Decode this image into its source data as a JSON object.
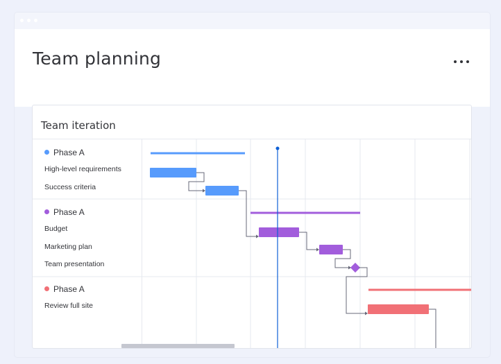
{
  "page": {
    "title": "Team planning",
    "more_icon": "more-horizontal-icon"
  },
  "card": {
    "title": "Team iteration"
  },
  "groups": [
    {
      "name": "Phase A",
      "color": "#579bfc",
      "tasks": [
        "High-level requirements",
        "Success criteria"
      ]
    },
    {
      "name": "Phase A",
      "color": "#a25ddc",
      "tasks": [
        "Budget",
        "Marketing plan",
        "Team presentation"
      ]
    },
    {
      "name": "Phase A",
      "color": "#f17076",
      "tasks": [
        "Review full site"
      ]
    }
  ],
  "colors": {
    "blue": "#579bfc",
    "purple": "#a25ddc",
    "red": "#f17076",
    "today_line": "#0e60d6",
    "grid": "#e6e9ef"
  }
}
